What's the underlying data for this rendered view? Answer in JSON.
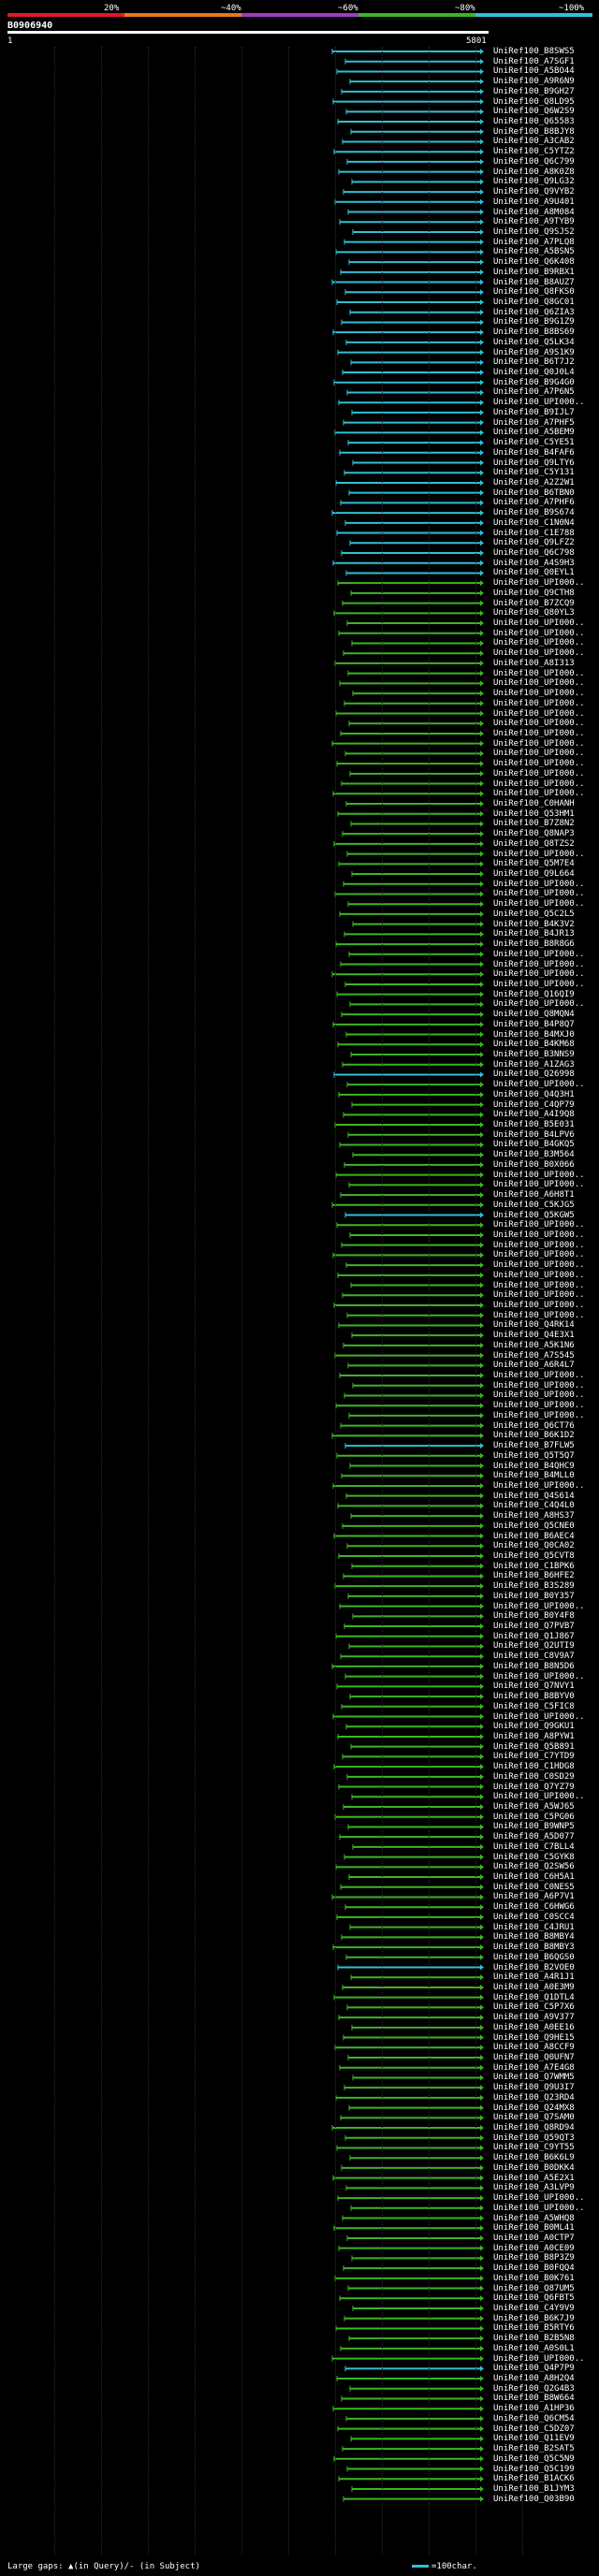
{
  "legend": {
    "labels": [
      "20%",
      "~40%",
      "~60%",
      "~80%",
      "~100%"
    ],
    "colors": [
      "#e0182a",
      "#e87a1a",
      "#a23ac4",
      "#3cb524",
      "#31c0d5"
    ]
  },
  "query": {
    "id": "B0906940",
    "start": "1",
    "end": "5801"
  },
  "rows": [
    {
      "label": "UniRef100_B8SWS5",
      "color": "#31c0d5"
    },
    {
      "label": "UniRef100_A7SGF1",
      "color": "#31c0d5"
    },
    {
      "label": "UniRef100_A5BO44",
      "color": "#31c0d5"
    },
    {
      "label": "UniRef100_A9R6N9",
      "color": "#31c0d5"
    },
    {
      "label": "UniRef100_B9GH27",
      "color": "#31c0d5"
    },
    {
      "label": "UniRef100_Q8LD95",
      "color": "#31c0d5"
    },
    {
      "label": "UniRef100_Q6W2S9",
      "color": "#31c0d5"
    },
    {
      "label": "UniRef100_Q65583",
      "color": "#31c0d5"
    },
    {
      "label": "UniRef100_B8BJY8",
      "color": "#31c0d5"
    },
    {
      "label": "UniRef100_A3CAB2",
      "color": "#31c0d5"
    },
    {
      "label": "UniRef100_C5YTZ2",
      "color": "#31c0d5"
    },
    {
      "label": "UniRef100_Q6C799",
      "color": "#31c0d5"
    },
    {
      "label": "UniRef100_A8K0Z8",
      "color": "#31c0d5"
    },
    {
      "label": "UniRef100_Q9LG32",
      "color": "#31c0d5"
    },
    {
      "label": "UniRef100_Q9VYB2",
      "color": "#31c0d5"
    },
    {
      "label": "UniRef100_A9U401",
      "color": "#31c0d5"
    },
    {
      "label": "UniRef100_A8M084",
      "color": "#31c0d5"
    },
    {
      "label": "UniRef100_A9TYB9",
      "color": "#31c0d5"
    },
    {
      "label": "UniRef100_Q9SJS2",
      "color": "#31c0d5"
    },
    {
      "label": "UniRef100_A7PLQ8",
      "color": "#31c0d5"
    },
    {
      "label": "UniRef100_A5BSN5",
      "color": "#31c0d5"
    },
    {
      "label": "UniRef100_Q6K408",
      "color": "#31c0d5"
    },
    {
      "label": "UniRef100_B9RBX1",
      "color": "#31c0d5"
    },
    {
      "label": "UniRef100_B8AUZ7",
      "color": "#31c0d5"
    },
    {
      "label": "UniRef100_Q8FKS0",
      "color": "#31c0d5"
    },
    {
      "label": "UniRef100_Q8GC01",
      "color": "#31c0d5"
    },
    {
      "label": "UniRef100_Q6ZIA3",
      "color": "#31c0d5"
    },
    {
      "label": "UniRef100_B9G1Z9",
      "color": "#31c0d5"
    },
    {
      "label": "UniRef100_B8BS69",
      "color": "#31c0d5"
    },
    {
      "label": "UniRef100_Q5LK34",
      "color": "#31c0d5"
    },
    {
      "label": "UniRef100_A9S1K9",
      "color": "#31c0d5"
    },
    {
      "label": "UniRef100_B6T7J2",
      "color": "#31c0d5"
    },
    {
      "label": "UniRef100_Q0J0L4",
      "color": "#31c0d5"
    },
    {
      "label": "UniRef100_B9G4G0",
      "color": "#31c0d5"
    },
    {
      "label": "UniRef100_A7P6N5",
      "color": "#31c0d5"
    },
    {
      "label": "UniRef100_UPI000..",
      "color": "#31c0d5"
    },
    {
      "label": "UniRef100_B9IJL7",
      "color": "#31c0d5"
    },
    {
      "label": "UniRef100_A7PHF5",
      "color": "#31c0d5"
    },
    {
      "label": "UniRef100_A5BEM9",
      "color": "#31c0d5"
    },
    {
      "label": "UniRef100_C5YE51",
      "color": "#31c0d5"
    },
    {
      "label": "UniRef100_B4FAF6",
      "color": "#31c0d5"
    },
    {
      "label": "UniRef100_Q9LTY6",
      "color": "#31c0d5"
    },
    {
      "label": "UniRef100_C5Y131",
      "color": "#31c0d5"
    },
    {
      "label": "UniRef100_A2Z2W1",
      "color": "#31c0d5"
    },
    {
      "label": "UniRef100_B6TBN0",
      "color": "#31c0d5"
    },
    {
      "label": "UniRef100_A7PHF6",
      "color": "#31c0d5"
    },
    {
      "label": "UniRef100_B9S674",
      "color": "#31c0d5"
    },
    {
      "label": "UniRef100_C1N0N4",
      "color": "#31c0d5"
    },
    {
      "label": "UniRef100_C1E788",
      "color": "#31c0d5"
    },
    {
      "label": "UniRef100_Q9LFZ2",
      "color": "#31c0d5"
    },
    {
      "label": "UniRef100_Q6C798",
      "color": "#31c0d5"
    },
    {
      "label": "UniRef100_A4S9H3",
      "color": "#31c0d5"
    },
    {
      "label": "UniRef100_Q0EYL1",
      "color": "#31c0d5"
    },
    {
      "label": "UniRef100_UPI000..",
      "color": "#3cb524"
    },
    {
      "label": "UniRef100_Q9CTH8",
      "color": "#3cb524"
    },
    {
      "label": "UniRef100_B7ZCQ9",
      "color": "#3cb524"
    },
    {
      "label": "UniRef100_Q80YL3",
      "color": "#3cb524"
    },
    {
      "label": "UniRef100_UPI000..",
      "color": "#3cb524"
    },
    {
      "label": "UniRef100_UPI000..",
      "color": "#3cb524"
    },
    {
      "label": "UniRef100_UPI000..",
      "color": "#3cb524"
    },
    {
      "label": "UniRef100_UPI000..",
      "color": "#3cb524"
    },
    {
      "label": "UniRef100_A8I313",
      "color": "#3cb524"
    },
    {
      "label": "UniRef100_UPI000..",
      "color": "#3cb524"
    },
    {
      "label": "UniRef100_UPI000..",
      "color": "#3cb524"
    },
    {
      "label": "UniRef100_UPI000..",
      "color": "#3cb524"
    },
    {
      "label": "UniRef100_UPI000..",
      "color": "#3cb524"
    },
    {
      "label": "UniRef100_UPI000..",
      "color": "#3cb524"
    },
    {
      "label": "UniRef100_UPI000..",
      "color": "#3cb524"
    },
    {
      "label": "UniRef100_UPI000..",
      "color": "#3cb524"
    },
    {
      "label": "UniRef100_UPI000..",
      "color": "#3cb524"
    },
    {
      "label": "UniRef100_UPI000..",
      "color": "#3cb524"
    },
    {
      "label": "UniRef100_UPI000..",
      "color": "#3cb524"
    },
    {
      "label": "UniRef100_UPI000..",
      "color": "#3cb524"
    },
    {
      "label": "UniRef100_UPI000..",
      "color": "#3cb524"
    },
    {
      "label": "UniRef100_UPI000..",
      "color": "#3cb524"
    },
    {
      "label": "UniRef100_C0HANH",
      "color": "#3cb524"
    },
    {
      "label": "UniRef100_Q53HM1",
      "color": "#3cb524"
    },
    {
      "label": "UniRef100_B7Z8N2",
      "color": "#3cb524"
    },
    {
      "label": "UniRef100_Q8NAP3",
      "color": "#3cb524"
    },
    {
      "label": "UniRef100_Q8TZS2",
      "color": "#3cb524"
    },
    {
      "label": "UniRef100_UPI000..",
      "color": "#3cb524"
    },
    {
      "label": "UniRef100_Q5M7E4",
      "color": "#3cb524"
    },
    {
      "label": "UniRef100_Q9L664",
      "color": "#3cb524"
    },
    {
      "label": "UniRef100_UPI000..",
      "color": "#3cb524"
    },
    {
      "label": "UniRef100_UPI000..",
      "color": "#3cb524"
    },
    {
      "label": "UniRef100_UPI000..",
      "color": "#3cb524"
    },
    {
      "label": "UniRef100_Q5C2L5",
      "color": "#3cb524"
    },
    {
      "label": "UniRef100_B4K3V2",
      "color": "#3cb524"
    },
    {
      "label": "UniRef100_B4JR13",
      "color": "#3cb524"
    },
    {
      "label": "UniRef100_B8R8G6",
      "color": "#3cb524"
    },
    {
      "label": "UniRef100_UPI000..",
      "color": "#3cb524"
    },
    {
      "label": "UniRef100_UPI000..",
      "color": "#3cb524"
    },
    {
      "label": "UniRef100_UPI000..",
      "color": "#3cb524"
    },
    {
      "label": "UniRef100_UPI000..",
      "color": "#3cb524"
    },
    {
      "label": "UniRef100_Q16QI9",
      "color": "#3cb524"
    },
    {
      "label": "UniRef100_UPI000..",
      "color": "#3cb524"
    },
    {
      "label": "UniRef100_Q8MQN4",
      "color": "#3cb524"
    },
    {
      "label": "UniRef100_B4P8Q7",
      "color": "#3cb524"
    },
    {
      "label": "UniRef100_B4MXJ0",
      "color": "#3cb524"
    },
    {
      "label": "UniRef100_B4KM68",
      "color": "#3cb524"
    },
    {
      "label": "UniRef100_B3NNS9",
      "color": "#3cb524"
    },
    {
      "label": "UniRef100_A1ZAG3",
      "color": "#3cb524"
    },
    {
      "label": "UniRef100_Q26998",
      "color": "#31c0d5"
    },
    {
      "label": "UniRef100_UPI000..",
      "color": "#3cb524"
    },
    {
      "label": "UniRef100_Q4Q3H1",
      "color": "#3cb524"
    },
    {
      "label": "UniRef100_C4QP79",
      "color": "#3cb524"
    },
    {
      "label": "UniRef100_A4I9Q8",
      "color": "#3cb524"
    },
    {
      "label": "UniRef100_B5E031",
      "color": "#3cb524"
    },
    {
      "label": "UniRef100_B4LPV6",
      "color": "#3cb524"
    },
    {
      "label": "UniRef100_B4GKQ5",
      "color": "#3cb524"
    },
    {
      "label": "UniRef100_B3M564",
      "color": "#3cb524"
    },
    {
      "label": "UniRef100_B0X066",
      "color": "#3cb524"
    },
    {
      "label": "UniRef100_UPI000..",
      "color": "#3cb524"
    },
    {
      "label": "UniRef100_UPI000..",
      "color": "#3cb524"
    },
    {
      "label": "UniRef100_A6H8T1",
      "color": "#3cb524"
    },
    {
      "label": "UniRef100_C5KJG5",
      "color": "#3cb524"
    },
    {
      "label": "UniRef100_Q5KGW5",
      "color": "#31c0d5"
    },
    {
      "label": "UniRef100_UPI000..",
      "color": "#3cb524"
    },
    {
      "label": "UniRef100_UPI000..",
      "color": "#3cb524"
    },
    {
      "label": "UniRef100_UPI000..",
      "color": "#3cb524"
    },
    {
      "label": "UniRef100_UPI000..",
      "color": "#3cb524"
    },
    {
      "label": "UniRef100_UPI000..",
      "color": "#3cb524"
    },
    {
      "label": "UniRef100_UPI000..",
      "color": "#3cb524"
    },
    {
      "label": "UniRef100_UPI000..",
      "color": "#3cb524"
    },
    {
      "label": "UniRef100_UPI000..",
      "color": "#3cb524"
    },
    {
      "label": "UniRef100_UPI000..",
      "color": "#3cb524"
    },
    {
      "label": "UniRef100_UPI000..",
      "color": "#3cb524"
    },
    {
      "label": "UniRef100_Q4RK14",
      "color": "#3cb524"
    },
    {
      "label": "UniRef100_Q4E3X1",
      "color": "#3cb524"
    },
    {
      "label": "UniRef100_A5K1N6",
      "color": "#3cb524"
    },
    {
      "label": "UniRef100_A7S545",
      "color": "#3cb524"
    },
    {
      "label": "UniRef100_A6R4L7",
      "color": "#3cb524"
    },
    {
      "label": "UniRef100_UPI000..",
      "color": "#3cb524"
    },
    {
      "label": "UniRef100_UPI000..",
      "color": "#3cb524"
    },
    {
      "label": "UniRef100_UPI000..",
      "color": "#3cb524"
    },
    {
      "label": "UniRef100_UPI000..",
      "color": "#3cb524"
    },
    {
      "label": "UniRef100_UPI000..",
      "color": "#3cb524"
    },
    {
      "label": "UniRef100_Q6CT76",
      "color": "#3cb524"
    },
    {
      "label": "UniRef100_B6K1D2",
      "color": "#3cb524"
    },
    {
      "label": "UniRef100_B7FLW5",
      "color": "#31c0d5"
    },
    {
      "label": "UniRef100_Q5T5Q7",
      "color": "#3cb524"
    },
    {
      "label": "UniRef100_B4QHC9",
      "color": "#3cb524"
    },
    {
      "label": "UniRef100_B4MLL0",
      "color": "#3cb524"
    },
    {
      "label": "UniRef100_UPI000..",
      "color": "#3cb524"
    },
    {
      "label": "UniRef100_Q4S614",
      "color": "#3cb524"
    },
    {
      "label": "UniRef100_C4Q4L0",
      "color": "#3cb524"
    },
    {
      "label": "UniRef100_A8HS37",
      "color": "#3cb524"
    },
    {
      "label": "UniRef100_Q5CNE0",
      "color": "#3cb524"
    },
    {
      "label": "UniRef100_B6AEC4",
      "color": "#3cb524"
    },
    {
      "label": "UniRef100_Q0CA02",
      "color": "#3cb524"
    },
    {
      "label": "UniRef100_Q5CVT8",
      "color": "#3cb524"
    },
    {
      "label": "UniRef100_C1BPK6",
      "color": "#3cb524"
    },
    {
      "label": "UniRef100_B6HFE2",
      "color": "#3cb524"
    },
    {
      "label": "UniRef100_B3S289",
      "color": "#3cb524"
    },
    {
      "label": "UniRef100_B0Y357",
      "color": "#3cb524"
    },
    {
      "label": "UniRef100_UPI000..",
      "color": "#3cb524"
    },
    {
      "label": "UniRef100_B0Y4F8",
      "color": "#3cb524"
    },
    {
      "label": "UniRef100_Q7PVB7",
      "color": "#3cb524"
    },
    {
      "label": "UniRef100_Q1J867",
      "color": "#3cb524"
    },
    {
      "label": "UniRef100_Q2UTI9",
      "color": "#3cb524"
    },
    {
      "label": "UniRef100_C8V9A7",
      "color": "#3cb524"
    },
    {
      "label": "UniRef100_B8N5D6",
      "color": "#3cb524"
    },
    {
      "label": "UniRef100_UPI000..",
      "color": "#3cb524"
    },
    {
      "label": "UniRef100_Q7NVY1",
      "color": "#3cb524"
    },
    {
      "label": "UniRef100_B8BYV0",
      "color": "#3cb524"
    },
    {
      "label": "UniRef100_C5FIC8",
      "color": "#3cb524"
    },
    {
      "label": "UniRef100_UPI000..",
      "color": "#3cb524"
    },
    {
      "label": "UniRef100_Q9GKU1",
      "color": "#3cb524"
    },
    {
      "label": "UniRef100_A8PYW1",
      "color": "#3cb524"
    },
    {
      "label": "UniRef100_Q5B891",
      "color": "#3cb524"
    },
    {
      "label": "UniRef100_C7YTD9",
      "color": "#3cb524"
    },
    {
      "label": "UniRef100_C1HDG8",
      "color": "#3cb524"
    },
    {
      "label": "UniRef100_C0SD29",
      "color": "#3cb524"
    },
    {
      "label": "UniRef100_Q7YZ79",
      "color": "#3cb524"
    },
    {
      "label": "UniRef100_UPI000..",
      "color": "#3cb524"
    },
    {
      "label": "UniRef100_A5WJ65",
      "color": "#3cb524"
    },
    {
      "label": "UniRef100_C5PG06",
      "color": "#3cb524"
    },
    {
      "label": "UniRef100_B9WNP5",
      "color": "#3cb524"
    },
    {
      "label": "UniRef100_A5D077",
      "color": "#3cb524"
    },
    {
      "label": "UniRef100_C7BLL4",
      "color": "#3cb524"
    },
    {
      "label": "UniRef100_C5GYK8",
      "color": "#3cb524"
    },
    {
      "label": "UniRef100_Q2SW56",
      "color": "#3cb524"
    },
    {
      "label": "UniRef100_C6H5A1",
      "color": "#3cb524"
    },
    {
      "label": "UniRef100_C0NES5",
      "color": "#3cb524"
    },
    {
      "label": "UniRef100_A6P7V1",
      "color": "#3cb524"
    },
    {
      "label": "UniRef100_C6HWG6",
      "color": "#3cb524"
    },
    {
      "label": "UniRef100_C0SCC4",
      "color": "#3cb524"
    },
    {
      "label": "UniRef100_C4JRU1",
      "color": "#3cb524"
    },
    {
      "label": "UniRef100_B8MBY4",
      "color": "#3cb524"
    },
    {
      "label": "UniRef100_B8MBY3",
      "color": "#3cb524"
    },
    {
      "label": "UniRef100_B6QGS0",
      "color": "#3cb524"
    },
    {
      "label": "UniRef100_B2VOE0",
      "color": "#31c0d5"
    },
    {
      "label": "UniRef100_A4R1J1",
      "color": "#3cb524"
    },
    {
      "label": "UniRef100_A0E3M9",
      "color": "#3cb524"
    },
    {
      "label": "UniRef100_Q1DTL4",
      "color": "#3cb524"
    },
    {
      "label": "UniRef100_C5P7X6",
      "color": "#3cb524"
    },
    {
      "label": "UniRef100_A9V377",
      "color": "#3cb524"
    },
    {
      "label": "UniRef100_A0EE16",
      "color": "#3cb524"
    },
    {
      "label": "UniRef100_Q9HE15",
      "color": "#3cb524"
    },
    {
      "label": "UniRef100_A8CCF9",
      "color": "#3cb524"
    },
    {
      "label": "UniRef100_Q0UFN7",
      "color": "#3cb524"
    },
    {
      "label": "UniRef100_A7E4G8",
      "color": "#3cb524"
    },
    {
      "label": "UniRef100_Q7WMM5",
      "color": "#3cb524"
    },
    {
      "label": "UniRef100_Q9U3I7",
      "color": "#3cb524"
    },
    {
      "label": "UniRef100_Q23RD4",
      "color": "#3cb524"
    },
    {
      "label": "UniRef100_Q24MX8",
      "color": "#3cb524"
    },
    {
      "label": "UniRef100_Q7SAM0",
      "color": "#3cb524"
    },
    {
      "label": "UniRef100_Q8RD94",
      "color": "#3cb524"
    },
    {
      "label": "UniRef100_Q59QT3",
      "color": "#3cb524"
    },
    {
      "label": "UniRef100_C9YT55",
      "color": "#3cb524"
    },
    {
      "label": "UniRef100_B6K6L9",
      "color": "#3cb524"
    },
    {
      "label": "UniRef100_B0DKK4",
      "color": "#3cb524"
    },
    {
      "label": "UniRef100_A5E2X1",
      "color": "#3cb524"
    },
    {
      "label": "UniRef100_A3LVP9",
      "color": "#3cb524"
    },
    {
      "label": "UniRef100_UPI000..",
      "color": "#3cb524"
    },
    {
      "label": "UniRef100_UPI000..",
      "color": "#3cb524"
    },
    {
      "label": "UniRef100_A5WHQ8",
      "color": "#3cb524"
    },
    {
      "label": "UniRef100_B0ML41",
      "color": "#3cb524"
    },
    {
      "label": "UniRef100_A0CTP7",
      "color": "#3cb524"
    },
    {
      "label": "UniRef100_A0CE09",
      "color": "#3cb524"
    },
    {
      "label": "UniRef100_B8P3Z9",
      "color": "#3cb524"
    },
    {
      "label": "UniRef100_B0FQQ4",
      "color": "#3cb524"
    },
    {
      "label": "UniRef100_B0K761",
      "color": "#3cb524"
    },
    {
      "label": "UniRef100_Q87UM5",
      "color": "#3cb524"
    },
    {
      "label": "UniRef100_Q6FBT5",
      "color": "#3cb524"
    },
    {
      "label": "UniRef100_C4Y9V9",
      "color": "#3cb524"
    },
    {
      "label": "UniRef100_B6K7J9",
      "color": "#3cb524"
    },
    {
      "label": "UniRef100_B5RTY6",
      "color": "#3cb524"
    },
    {
      "label": "UniRef100_B2B5N8",
      "color": "#3cb524"
    },
    {
      "label": "UniRef100_A0S0L1",
      "color": "#3cb524"
    },
    {
      "label": "UniRef100_UPI000..",
      "color": "#3cb524"
    },
    {
      "label": "UniRef100_Q4P7P9",
      "color": "#31c0d5"
    },
    {
      "label": "UniRef100_A8H2Q4",
      "color": "#3cb524"
    },
    {
      "label": "UniRef100_Q2G4B3",
      "color": "#3cb524"
    },
    {
      "label": "UniRef100_B8W664",
      "color": "#3cb524"
    },
    {
      "label": "UniRef100_A1HP36",
      "color": "#3cb524"
    },
    {
      "label": "UniRef100_Q6CM54",
      "color": "#3cb524"
    },
    {
      "label": "UniRef100_C5DZ07",
      "color": "#3cb524"
    },
    {
      "label": "UniRef100_Q11EV9",
      "color": "#3cb524"
    },
    {
      "label": "UniRef100_B2SAT5",
      "color": "#3cb524"
    },
    {
      "label": "UniRef100_Q5C5N9",
      "color": "#3cb524"
    },
    {
      "label": "UniRef100_Q5C199",
      "color": "#3cb524"
    },
    {
      "label": "UniRef100_B1ACK6",
      "color": "#3cb524"
    },
    {
      "label": "UniRef100_B1JYM3",
      "color": "#3cb524"
    },
    {
      "label": "UniRef100_Q03B90",
      "color": "#3cb524"
    }
  ],
  "footer": {
    "text": "Large gaps: ▲(in Query)/- (in Subject)",
    "scale_text": "=100char."
  }
}
